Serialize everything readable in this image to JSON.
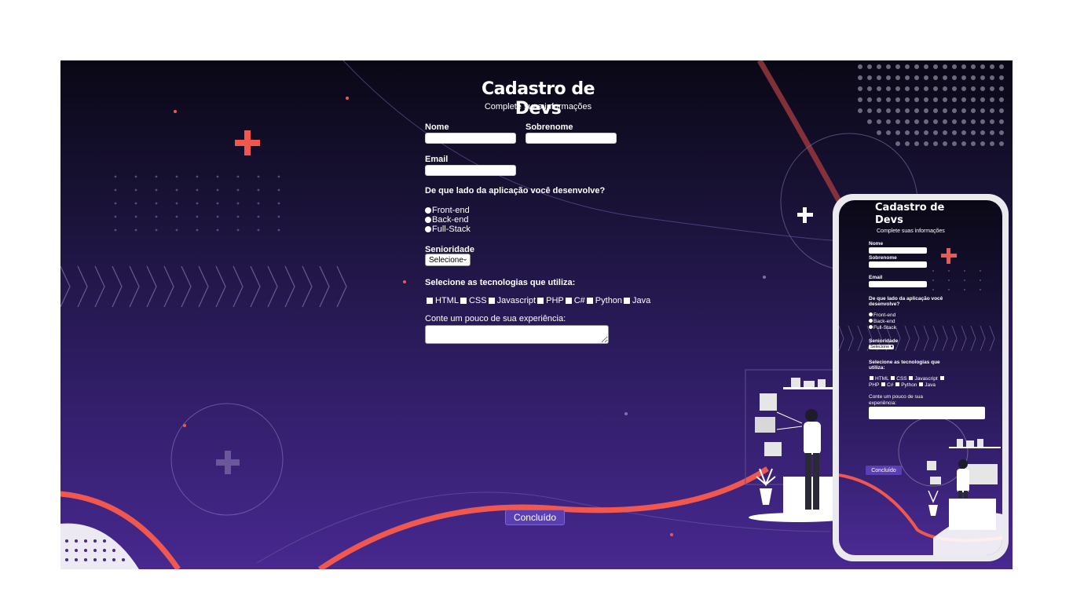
{
  "form": {
    "title": "Cadastro de Devs",
    "subtitle": "Complete suas informações",
    "fields": {
      "first_name_label": "Nome",
      "last_name_label": "Sobrenome",
      "email_label": "Email"
    },
    "side_question": "De que lado da aplicação você desenvolve?",
    "side_options": [
      "Front-end",
      "Back-end",
      "Full-Stack"
    ],
    "seniority_label": "Senioridade",
    "seniority_selected": "Selecione",
    "tech_question": "Selecione as tecnologias que utiliza:",
    "tech_options": [
      "HTML",
      "CSS",
      "Javascript",
      "PHP",
      "C#",
      "Python",
      "Java"
    ],
    "experience_label": "Conte um pouco de sua experiência:",
    "submit_label": "Concluído"
  },
  "mobile": {
    "title_line1": "Cadastro de",
    "title_line2": "Devs",
    "subtitle": "Complete suas informações",
    "first_name_label": "Nome",
    "last_name_label": "Sobrenome",
    "email_label": "Email",
    "side_question_line1": "De que lado da aplicação você",
    "side_question_line2": "desenvolve?",
    "side_options": [
      "Front-end",
      "Back-end",
      "Full-Stack"
    ],
    "seniority_label": "Senioridade",
    "seniority_selected": "Selecione",
    "tech_question_line1": "Selecione as tecnologias que",
    "tech_question_line2": "utiliza:",
    "tech_options": [
      "HTML",
      "CSS",
      "Javascript",
      "PHP",
      "C#",
      "Python",
      "Java"
    ],
    "experience_label_line1": "Conte um pouco de sua",
    "experience_label_line2": "experiência:",
    "submit_label": "Concluído"
  },
  "colors": {
    "accent_coral": "#f0584f",
    "button_purple": "#5a3fb2",
    "bg_top": "#0a0816",
    "bg_bottom": "#47288f"
  },
  "icons": [
    "plus-icon",
    "chevron-down-icon"
  ]
}
